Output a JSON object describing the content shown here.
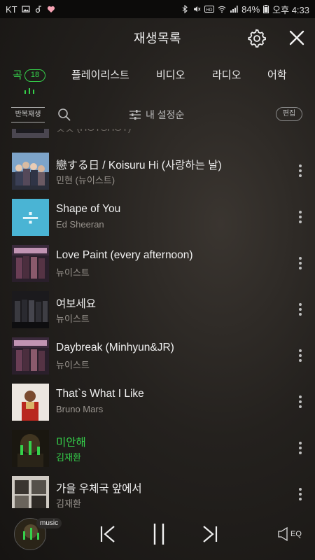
{
  "status_bar": {
    "carrier": "KT",
    "battery": "84%",
    "time": "오후 4:33"
  },
  "header": {
    "title": "재생목록"
  },
  "tabs": [
    {
      "label": "곡",
      "count": "18",
      "active": true
    },
    {
      "label": "플레이리스트"
    },
    {
      "label": "비디오"
    },
    {
      "label": "라디오"
    },
    {
      "label": "어학"
    }
  ],
  "toolbar": {
    "repeat_label": "반복재생",
    "sort_label": "내 설정순",
    "edit_label": "편집"
  },
  "partial_track": {
    "title": "핫샷 (HOTSHOT)"
  },
  "tracks": [
    {
      "title": "戀する日 / Koisuru Hi (사랑하는 날)",
      "artist": "민현 (뉴이스트)"
    },
    {
      "title": "Shape of You",
      "artist": "Ed Sheeran"
    },
    {
      "title": "Love Paint (every afternoon)",
      "artist": "뉴이스트"
    },
    {
      "title": "여보세요",
      "artist": "뉴이스트"
    },
    {
      "title": "Daybreak (Minhyun&JR)",
      "artist": "뉴이스트"
    },
    {
      "title": "That`s What I Like",
      "artist": "Bruno Mars"
    },
    {
      "title": "미안해",
      "artist": "김재환",
      "playing": true
    },
    {
      "title": "가을 우체국 앞에서",
      "artist": "김재환"
    }
  ],
  "player": {
    "badge": "music",
    "eq_label": "EQ"
  },
  "colors": {
    "accent": "#35d14b",
    "background": "#24211e"
  }
}
